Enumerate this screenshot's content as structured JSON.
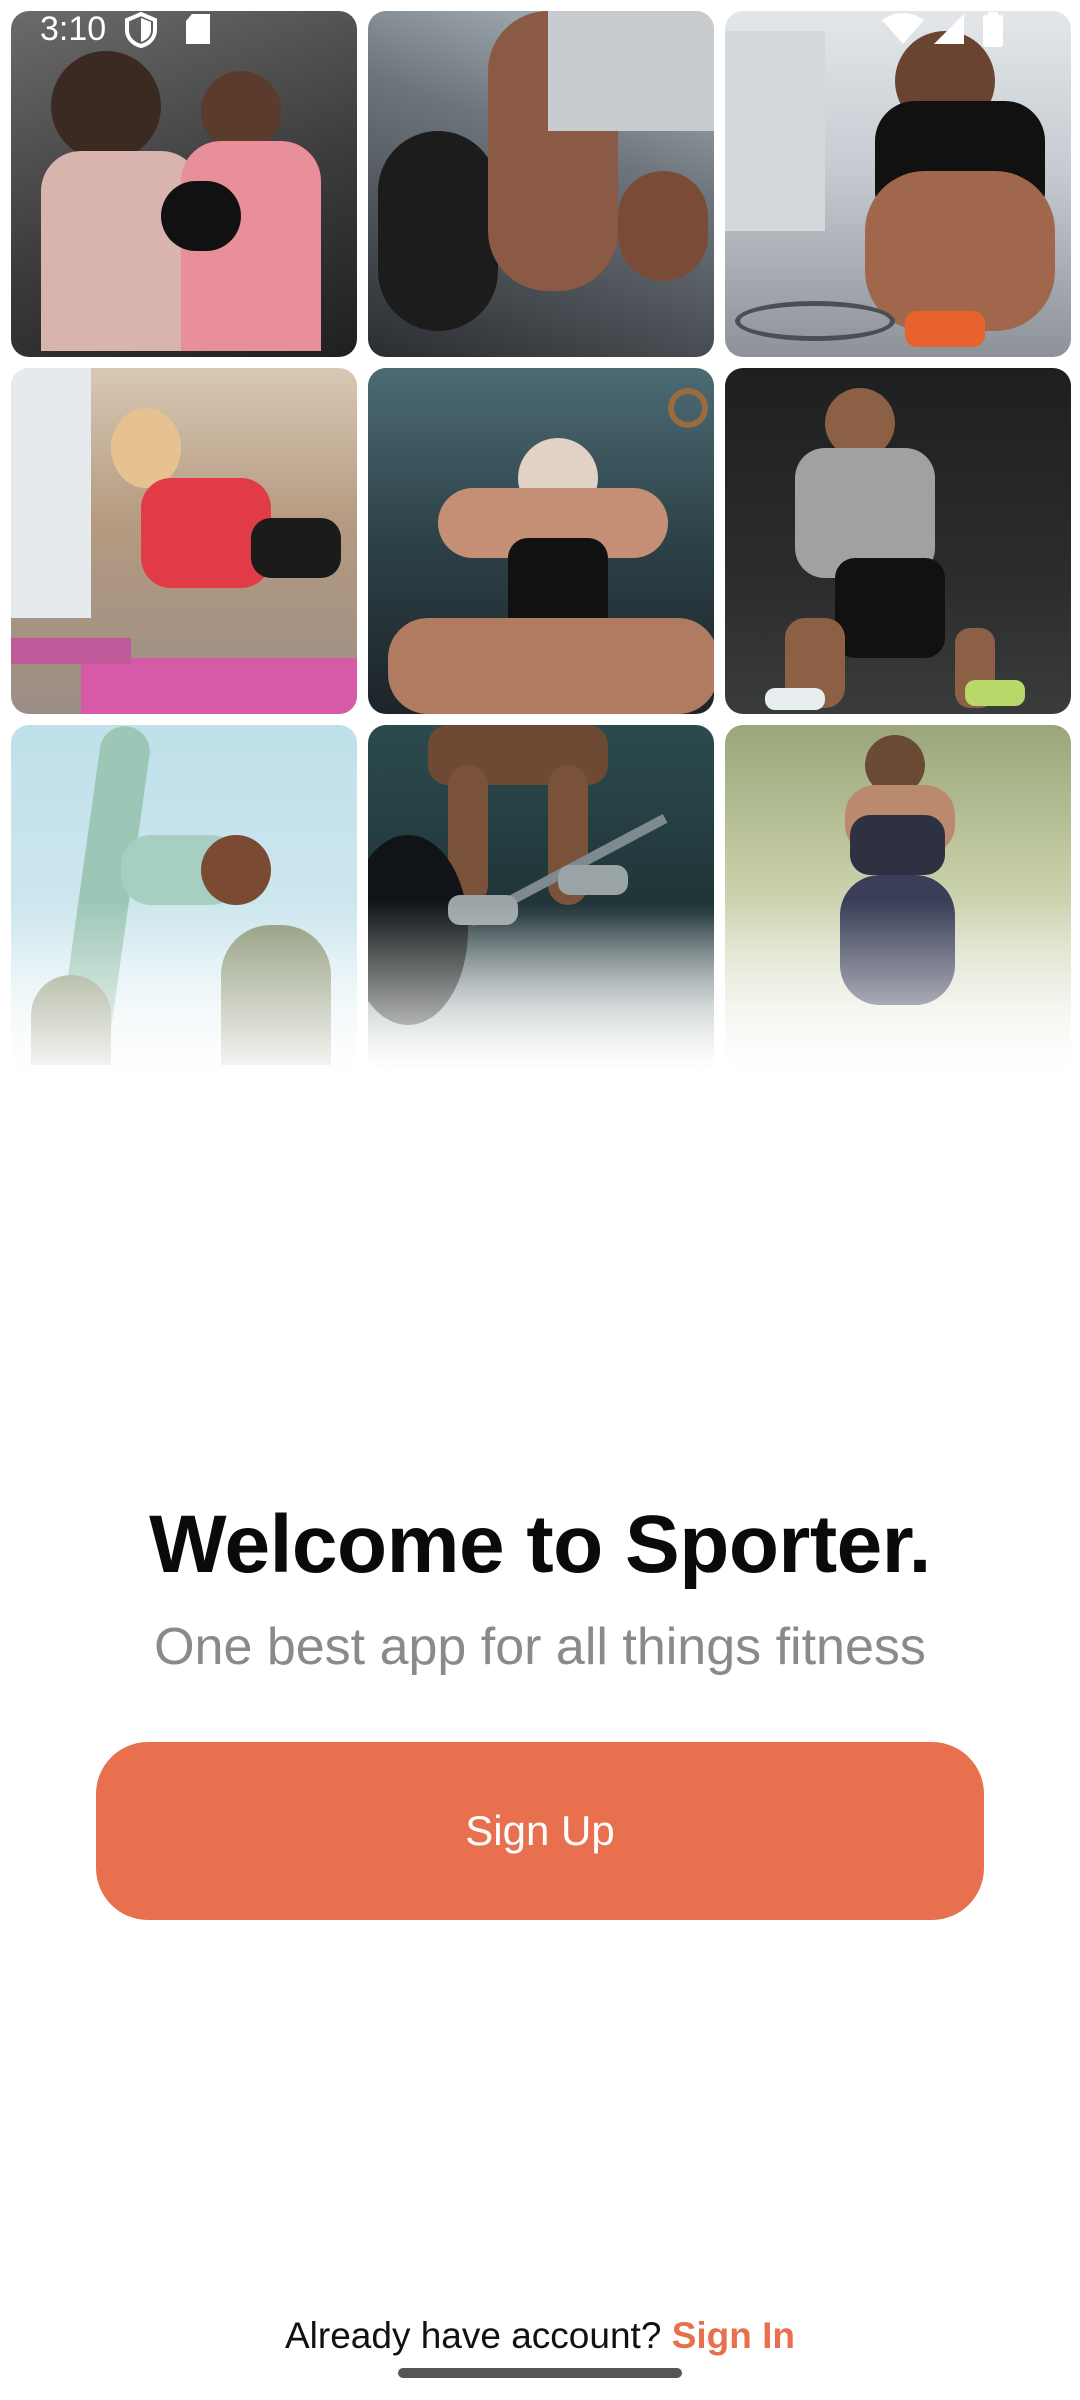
{
  "status_bar": {
    "time": "3:10",
    "icons": [
      "shield-icon",
      "sd-card-icon",
      "wifi-icon",
      "signal-icon",
      "battery-icon"
    ]
  },
  "photo_grid": {
    "tiles": [
      {
        "name": "photo-women-boxing"
      },
      {
        "name": "photo-dumbbell-grip"
      },
      {
        "name": "photo-man-tying-shoe"
      },
      {
        "name": "photo-woman-mat-exercise"
      },
      {
        "name": "photo-woman-situp"
      },
      {
        "name": "photo-man-lunge"
      },
      {
        "name": "photo-woman-yoga-stretch"
      },
      {
        "name": "photo-barbell-lift"
      },
      {
        "name": "photo-woman-running"
      }
    ]
  },
  "welcome": {
    "title": "Welcome to Sporter.",
    "subtitle": "One best app for all things fitness"
  },
  "actions": {
    "signup_label": "Sign Up",
    "existing_prompt": "Already have account? ",
    "signin_label": "Sign In"
  },
  "colors": {
    "accent": "#e8704f",
    "title_text": "#0a0a0a",
    "subtitle_text": "#8a8a8a"
  }
}
